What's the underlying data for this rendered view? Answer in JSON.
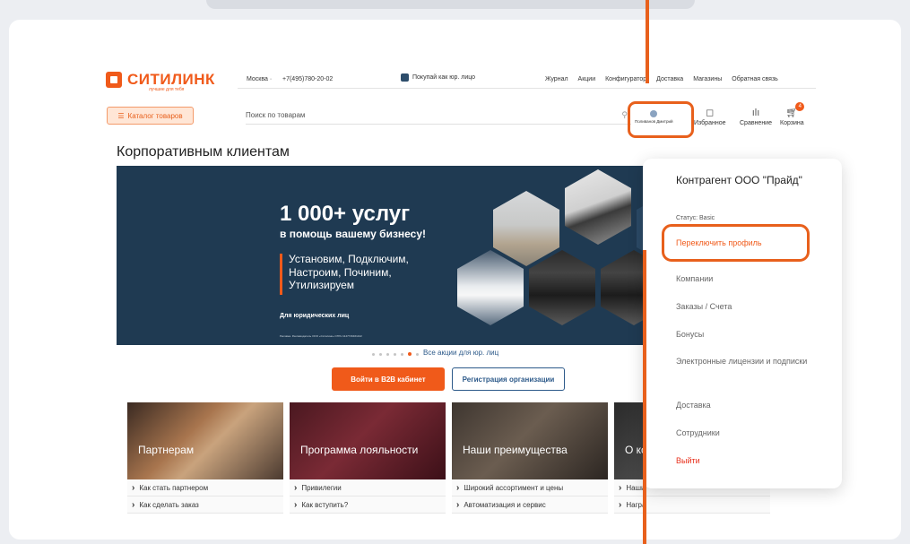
{
  "header": {
    "logo_text": "СИТИЛИНК",
    "logo_tagline": "лучшие для тебя",
    "city": "Москва ·",
    "phone": "+7(495)780-20-02",
    "b2b_link": "Покупай как юр. лицо",
    "nav": [
      "Журнал",
      "Акции",
      "Конфигуратор",
      "Доставка",
      "Магазины",
      "Обратная связь"
    ],
    "catalog_button": "Каталог товаров",
    "search_placeholder": "Поиск по товарам",
    "profile_label": "Поливанов Дмитрий",
    "favorites_label": "Избранное",
    "compare_label": "Сравнение",
    "cart_label": "Корзина",
    "cart_count": "4"
  },
  "page": {
    "title": "Корпоративным клиентам"
  },
  "banner": {
    "heading": "1 000+ услуг",
    "subheading": "в помощь вашему бизнесу!",
    "services": [
      "Установим, Подключим,",
      "Настроим, Починим,",
      "Утилизируем"
    ],
    "audience": "Для юридических лиц",
    "fine_print": "Реклама. Рекламодатель ООО «Ситилинк» ОГРН 1147746461422",
    "slides_total": 7,
    "slide_active": 6,
    "all_promos_link": "Все акции для юр. лиц"
  },
  "buttons": {
    "b2b_cabinet": "Войти в B2B кабинет",
    "register_org": "Регистрация организации"
  },
  "tiles": [
    {
      "title": "Партнерам",
      "links": [
        "Как стать партнером",
        "Как сделать заказ"
      ]
    },
    {
      "title": "Программа лояльности",
      "links": [
        "Привилегии",
        "Как вступить?"
      ]
    },
    {
      "title": "Наши преимущества",
      "links": [
        "Широкий ассортимент и цены",
        "Автоматизация и сервис"
      ]
    },
    {
      "title": "О ко",
      "links": [
        "Наши",
        "Награ"
      ]
    }
  ],
  "profile_menu": {
    "counterparty": "Контрагент ООО \"Прайд\"",
    "status": "Статус: Basic",
    "switch_profile": "Переключить профиль",
    "items": [
      "Компании",
      "Заказы / Счета",
      "Бонусы",
      "Электронные лицензии и подписки",
      "Доставка",
      "Сотрудники"
    ],
    "logout": "Выйти"
  },
  "colors": {
    "accent": "#f05a1a",
    "highlight": "#e8601c",
    "link": "#2d5a8a",
    "banner_bg": "#1f3a52"
  }
}
